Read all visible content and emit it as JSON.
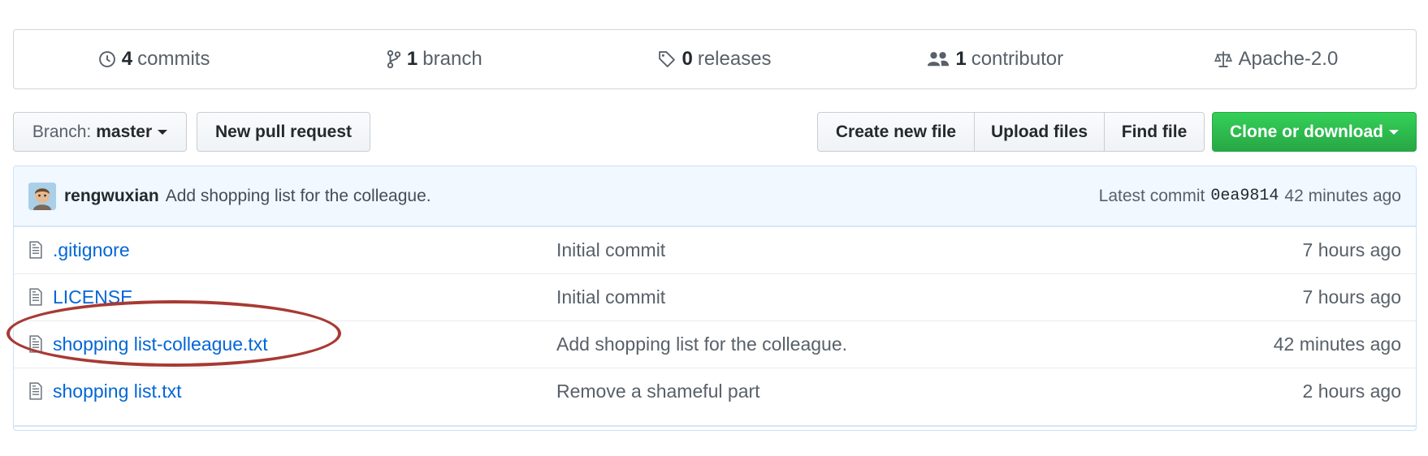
{
  "summary": {
    "commits_count": "4",
    "commits_label": "commits",
    "branch_count": "1",
    "branch_label": "branch",
    "releases_count": "0",
    "releases_label": "releases",
    "contributor_count": "1",
    "contributor_label": "contributor",
    "license": "Apache-2.0"
  },
  "toolbar": {
    "branch_prefix": "Branch:",
    "branch_name": "master",
    "new_pull_request": "New pull request",
    "create_new_file": "Create new file",
    "upload_files": "Upload files",
    "find_file": "Find file",
    "clone_or_download": "Clone or download"
  },
  "latest_commit": {
    "author": "rengwuxian",
    "message": "Add shopping list for the colleague.",
    "prefix": "Latest commit",
    "sha": "0ea9814",
    "age": "42 minutes ago"
  },
  "files": [
    {
      "name": ".gitignore",
      "message": "Initial commit",
      "age": "7 hours ago"
    },
    {
      "name": "LICENSE",
      "message": "Initial commit",
      "age": "7 hours ago"
    },
    {
      "name": "shopping list-colleague.txt",
      "message": "Add shopping list for the colleague.",
      "age": "42 minutes ago"
    },
    {
      "name": "shopping list.txt",
      "message": "Remove a shameful part",
      "age": "2 hours ago"
    }
  ],
  "colors": {
    "link": "#0366d6",
    "clone_green": "#28a745",
    "commit_bg": "#f1f8ff",
    "annotation_red": "#a73a33"
  },
  "icons": [
    "history-icon",
    "branch-icon",
    "tag-icon",
    "people-icon",
    "law-icon",
    "file-icon",
    "avatar"
  ]
}
